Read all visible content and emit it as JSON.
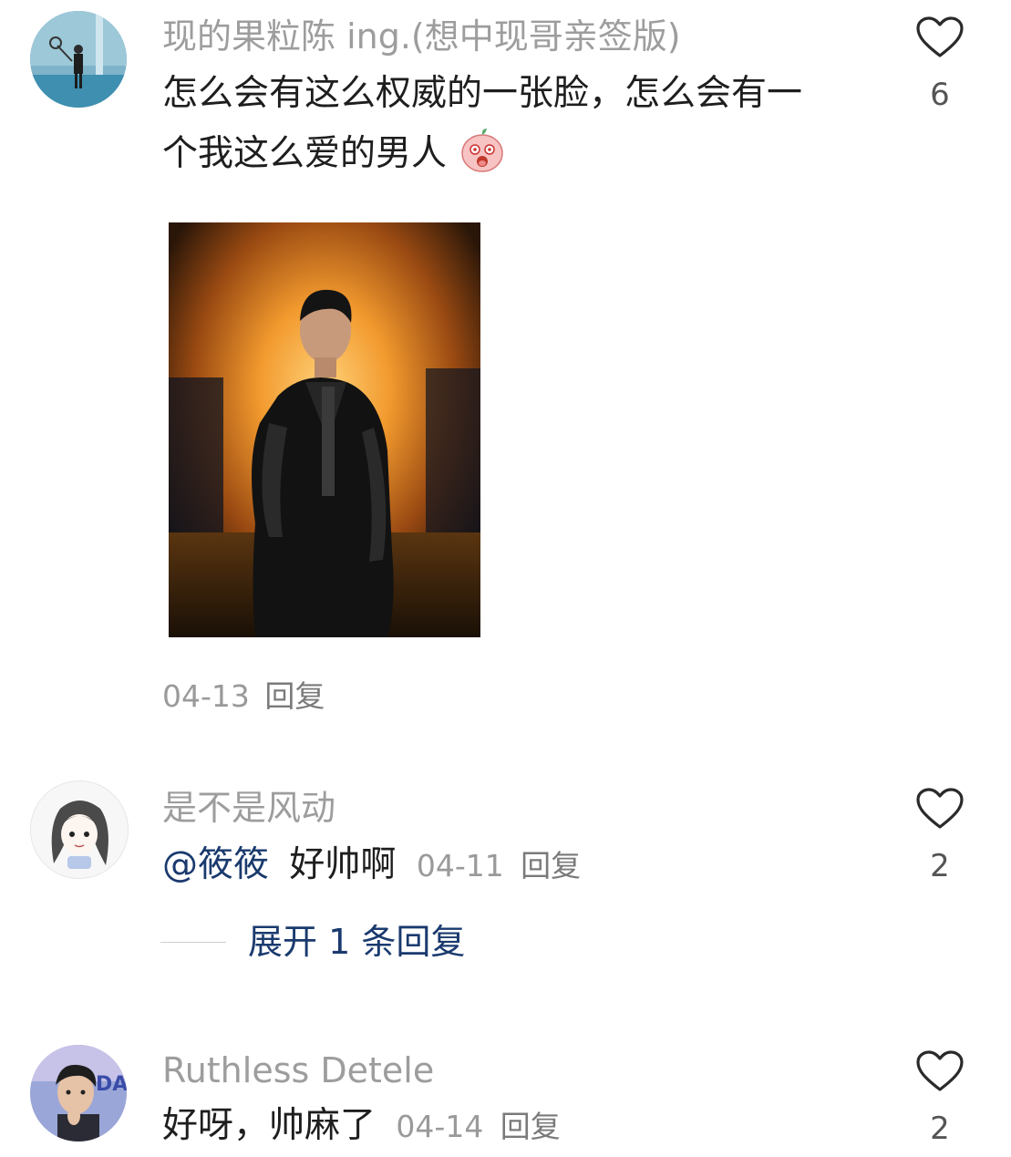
{
  "comments": [
    {
      "username": "现的果粒陈 ing.(想中现哥亲签版)",
      "text_line1": "怎么会有这么权威的一张脸，怎么会有一",
      "text_line2": "个我这么爱的男人",
      "emoji": "blushing-face-emoji",
      "has_image": true,
      "date": "04-13",
      "reply_label": "回复",
      "likes": "6"
    },
    {
      "username": "是不是风动",
      "mention": "@筱筱",
      "text": "好帅啊",
      "date": "04-11",
      "reply_label": "回复",
      "likes": "2",
      "expand_label": "展开 1 条回复"
    },
    {
      "username": "Ruthless Detele",
      "text_partial": "好呀，帅麻了",
      "date": "04-14",
      "reply_label": "回复",
      "likes": "2"
    }
  ],
  "colors": {
    "username": "#9d9d9d",
    "text": "#1e1e1e",
    "link": "#1a3a6e",
    "meta": "#9a9a9a"
  },
  "icons": [
    "heart-outline-icon"
  ]
}
